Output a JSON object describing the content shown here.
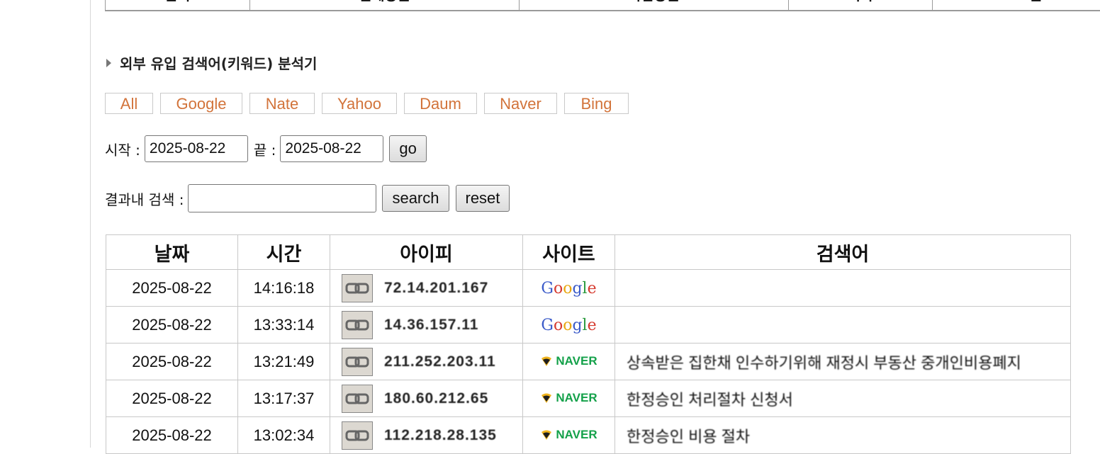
{
  "top_table": {
    "headers": [
      "날짜",
      "전체방문",
      "직접방문",
      "기타",
      "오즈맨"
    ]
  },
  "section": {
    "title": "외부 유입 검색어(키워드) 분석기"
  },
  "filters": [
    "All",
    "Google",
    "Nate",
    "Yahoo",
    "Daum",
    "Naver",
    "Bing"
  ],
  "date_form": {
    "start_label": "시작 :",
    "start_value": "2025-08-22",
    "end_label": "끝 :",
    "end_value": "2025-08-22",
    "go_label": "go"
  },
  "search_form": {
    "label": "결과내 검색 :",
    "value": "",
    "search_label": "search",
    "reset_label": "reset"
  },
  "table": {
    "headers": [
      "날짜",
      "시간",
      "아이피",
      "사이트",
      "검색어"
    ],
    "rows": [
      {
        "date": "2025-08-22",
        "time": "14:16:18",
        "ip": "72.14.201.167",
        "site": "Google",
        "keyword": ""
      },
      {
        "date": "2025-08-22",
        "time": "13:33:14",
        "ip": "14.36.157.11",
        "site": "Google",
        "keyword": ""
      },
      {
        "date": "2025-08-22",
        "time": "13:21:49",
        "ip": "211.252.203.11",
        "site": "NAVER",
        "keyword": "상속받은 집한채 인수하기위해 재정시 부동산 중개인비용폐지"
      },
      {
        "date": "2025-08-22",
        "time": "13:17:37",
        "ip": "180.60.212.65",
        "site": "NAVER",
        "keyword": "한정승인 처리절차 신청서"
      },
      {
        "date": "2025-08-22",
        "time": "13:02:34",
        "ip": "112.218.28.135",
        "site": "NAVER",
        "keyword": "한정승인 비용 절차"
      }
    ]
  },
  "colors": {
    "accent": "#d2733a",
    "naver_green": "#14a14a",
    "border": "#c8c8c8"
  },
  "icons": {
    "ip_link": "link-icon",
    "section_bullet": "triangle-icon"
  }
}
